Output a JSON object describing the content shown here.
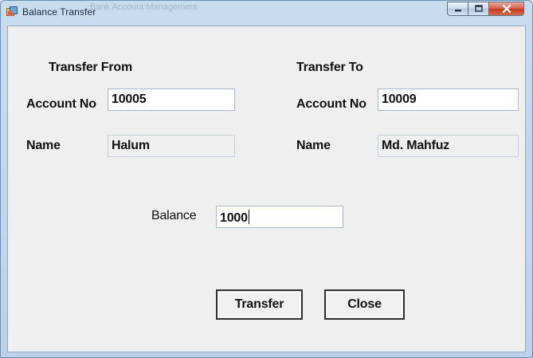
{
  "window": {
    "title": "Balance Transfer",
    "ghost_title": "Bank Account Management"
  },
  "from": {
    "heading": "Transfer From",
    "account_label": "Account No",
    "account_value": "10005",
    "name_label": "Name",
    "name_value": "Halum"
  },
  "to": {
    "heading": "Transfer To",
    "account_label": "Account No",
    "account_value": "10009",
    "name_label": "Name",
    "name_value": "Md. Mahfuz"
  },
  "balance": {
    "label": "Balance",
    "value": "1000"
  },
  "buttons": {
    "transfer": "Transfer",
    "close": "Close"
  }
}
